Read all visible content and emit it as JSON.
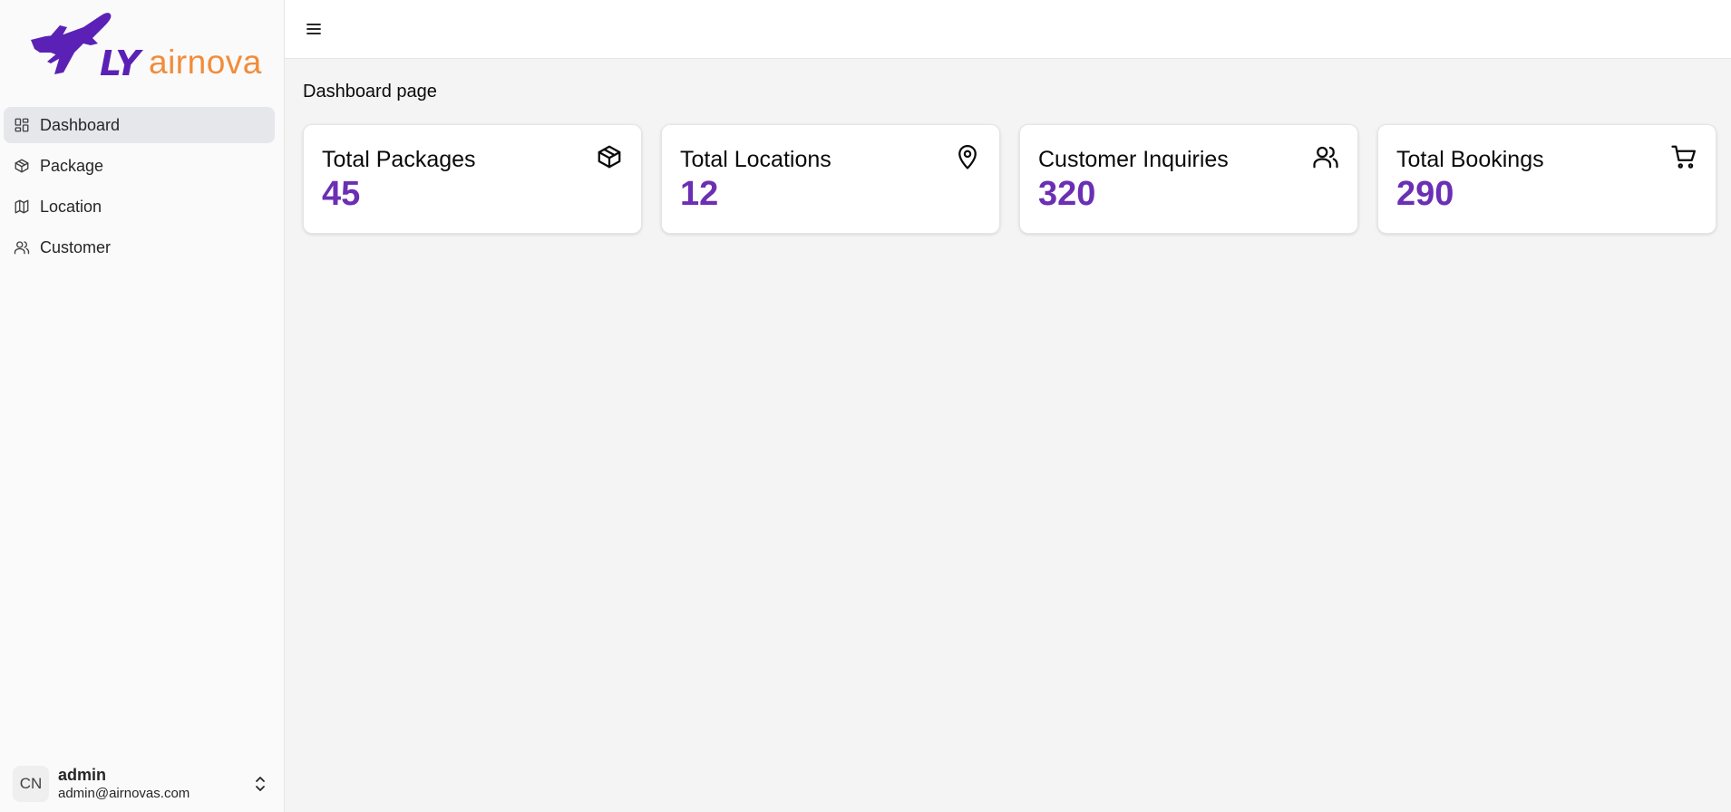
{
  "brand": {
    "logo_fly": "LY",
    "logo_name": "airnova",
    "primary_color": "#5b21b6",
    "accent_color": "#f28c3a"
  },
  "sidebar": {
    "items": [
      {
        "label": "Dashboard",
        "icon": "dashboard-icon",
        "active": true
      },
      {
        "label": "Package",
        "icon": "package-icon",
        "active": false
      },
      {
        "label": "Location",
        "icon": "map-icon",
        "active": false
      },
      {
        "label": "Customer",
        "icon": "users-icon",
        "active": false
      }
    ],
    "user": {
      "initials": "CN",
      "name": "admin",
      "email": "admin@airnovas.com"
    }
  },
  "header": {
    "menu_icon": "menu-icon"
  },
  "main": {
    "page_title": "Dashboard page",
    "cards": [
      {
        "title": "Total Packages",
        "value": "45",
        "icon": "package-icon"
      },
      {
        "title": "Total Locations",
        "value": "12",
        "icon": "map-pin-icon"
      },
      {
        "title": "Customer Inquiries",
        "value": "320",
        "icon": "users-icon"
      },
      {
        "title": "Total Bookings",
        "value": "290",
        "icon": "cart-icon"
      }
    ],
    "value_color": "#6b2fb3"
  }
}
